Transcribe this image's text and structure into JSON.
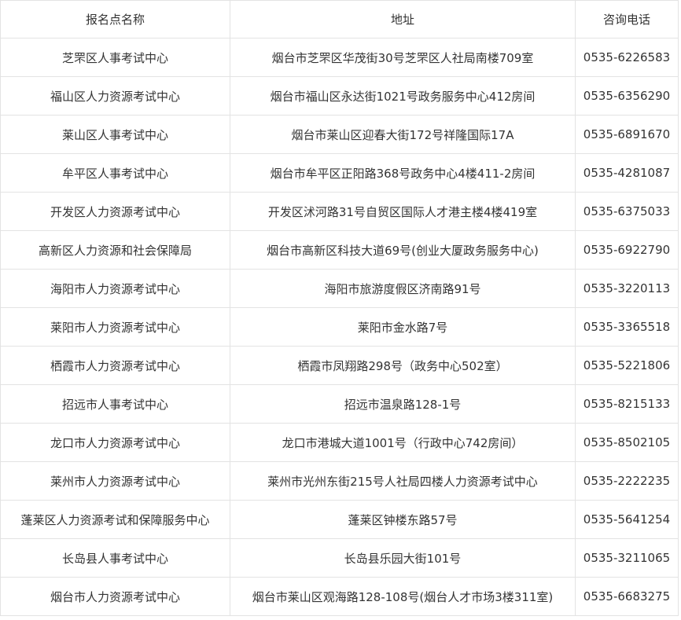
{
  "table": {
    "headers": [
      "报名点名称",
      "地址",
      "咨询电话"
    ],
    "rows": [
      {
        "name": "芝罘区人事考试中心",
        "address": "烟台市芝罘区华茂街30号芝罘区人社局南楼709室",
        "phone": "0535-6226583"
      },
      {
        "name": "福山区人力资源考试中心",
        "address": "烟台市福山区永达街1021号政务服务中心412房间",
        "phone": "0535-6356290"
      },
      {
        "name": "莱山区人事考试中心",
        "address": "烟台市莱山区迎春大街172号祥隆国际17A",
        "phone": "0535-6891670"
      },
      {
        "name": "牟平区人事考试中心",
        "address": "烟台市牟平区正阳路368号政务中心4楼411-2房间",
        "phone": "0535-4281087"
      },
      {
        "name": "开发区人力资源考试中心",
        "address": "开发区沭河路31号自贸区国际人才港主楼4楼419室",
        "phone": "0535-6375033"
      },
      {
        "name": "高新区人力资源和社会保障局",
        "address": "烟台市高新区科技大道69号(创业大厦政务服务中心)",
        "phone": "0535-6922790"
      },
      {
        "name": "海阳市人力资源考试中心",
        "address": "海阳市旅游度假区济南路91号",
        "phone": "0535-3220113"
      },
      {
        "name": "莱阳市人力资源考试中心",
        "address": "莱阳市金水路7号",
        "phone": "0535-3365518"
      },
      {
        "name": "栖霞市人力资源考试中心",
        "address": "栖霞市凤翔路298号（政务中心502室）",
        "phone": "0535-5221806"
      },
      {
        "name": "招远市人事考试中心",
        "address": "招远市温泉路128-1号",
        "phone": "0535-8215133"
      },
      {
        "name": "龙口市人力资源考试中心",
        "address": "龙口市港城大道1001号（行政中心742房间）",
        "phone": "0535-8502105"
      },
      {
        "name": "莱州市人力资源考试中心",
        "address": "莱州市光州东街215号人社局四楼人力资源考试中心",
        "phone": "0535-2222235"
      },
      {
        "name": "蓬莱区人力资源考试和保障服务中心",
        "address": "蓬莱区钟楼东路57号",
        "phone": "0535-5641254"
      },
      {
        "name": "长岛县人事考试中心",
        "address": "长岛县乐园大街101号",
        "phone": "0535-3211065"
      },
      {
        "name": "烟台市人力资源考试中心",
        "address": "烟台市莱山区观海路128-108号(烟台人才市场3楼311室)",
        "phone": "0535-6683275"
      }
    ]
  }
}
